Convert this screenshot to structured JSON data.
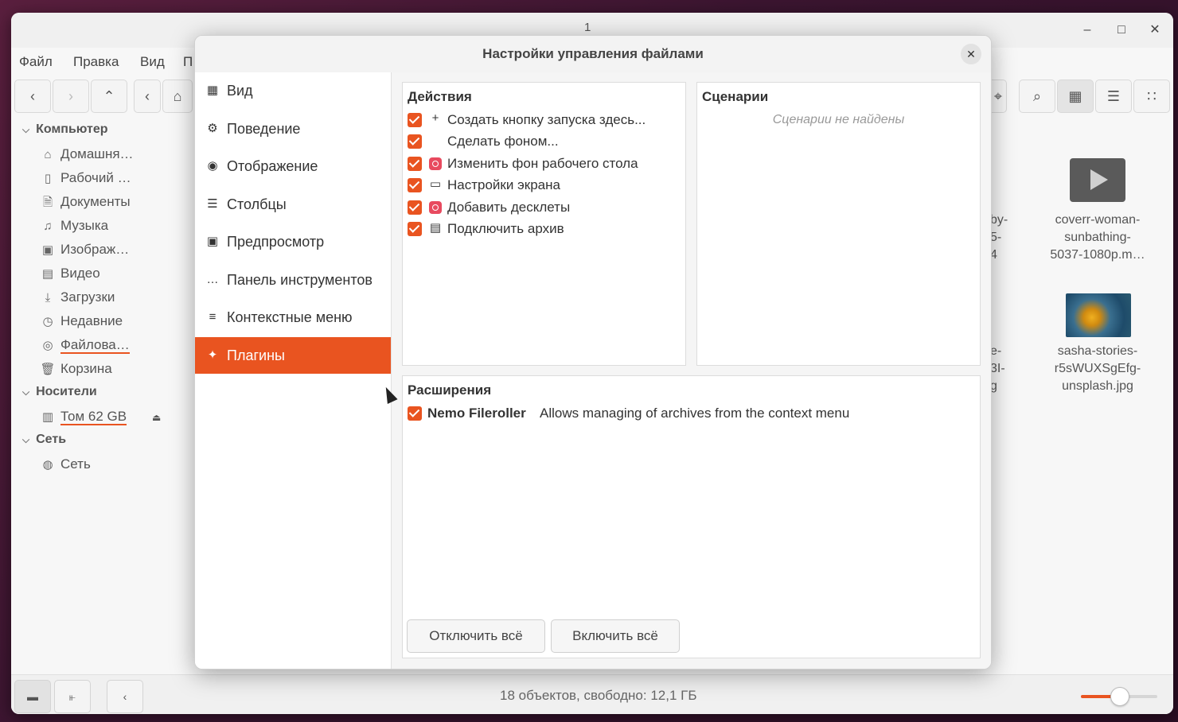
{
  "main_window": {
    "title": "1",
    "controls": {
      "minimize": "–",
      "maximize": "□",
      "close": "✕"
    },
    "menu": [
      "Файл",
      "Правка",
      "Вид",
      "П"
    ],
    "sidebar": {
      "computer_title": "Компьютер",
      "computer_items": [
        {
          "label": "Домашня…",
          "icon": "home-icon"
        },
        {
          "label": "Рабочий …",
          "icon": "desktop-icon"
        },
        {
          "label": "Документы",
          "icon": "documents-icon"
        },
        {
          "label": "Музыка",
          "icon": "music-icon"
        },
        {
          "label": "Изображ…",
          "icon": "pictures-icon"
        },
        {
          "label": "Видео",
          "icon": "video-icon"
        },
        {
          "label": "Загрузки",
          "icon": "downloads-icon"
        },
        {
          "label": "Недавние",
          "icon": "recent-icon"
        },
        {
          "label": "Файлова…",
          "icon": "filesystem-icon"
        },
        {
          "label": "Корзина",
          "icon": "trash-icon"
        }
      ],
      "devices_title": "Носители",
      "devices_items": [
        {
          "label": "Том 62 GB",
          "icon": "drive-icon"
        }
      ],
      "network_title": "Сеть",
      "network_items": [
        {
          "label": "Сеть",
          "icon": "network-icon"
        }
      ]
    },
    "files": [
      {
        "name_lines": [
          "coverr-woman-",
          "sunbathing-",
          "5037-1080p.m…"
        ],
        "thumb": "video-thumbnail"
      },
      {
        "name_lines": [
          "sasha-stories-",
          "r5sWUXSgEfg-",
          "unsplash.jpg"
        ],
        "thumb": "image-thumbnail"
      }
    ],
    "partial_file_labels": [
      "by-",
      "5-",
      "4",
      "e-",
      "3I-",
      "g"
    ],
    "status": "18 объектов, свободно: 12,1 ГБ",
    "zoom_level": 0.5
  },
  "dialog": {
    "title": "Настройки управления файлами",
    "close": "✕",
    "nav": [
      {
        "label": "Вид",
        "icon": "grid-icon",
        "selected": false
      },
      {
        "label": "Поведение",
        "icon": "gear-icon",
        "selected": false
      },
      {
        "label": "Отображение",
        "icon": "eye-icon",
        "selected": false
      },
      {
        "label": "Столбцы",
        "icon": "columns-icon",
        "selected": false
      },
      {
        "label": "Предпросмотр",
        "icon": "preview-icon",
        "selected": false
      },
      {
        "label": "Панель инструментов",
        "icon": "toolbar-icon",
        "selected": false
      },
      {
        "label": "Контекстные меню",
        "icon": "menu-icon",
        "selected": false
      },
      {
        "label": "Плагины",
        "icon": "puzzle-icon",
        "selected": true
      }
    ],
    "actions": {
      "title": "Действия",
      "items": [
        {
          "label": "Создать кнопку запуска здесь...",
          "icon": "plus-icon",
          "checked": true
        },
        {
          "label": "Сделать фоном...",
          "icon": "",
          "checked": true
        },
        {
          "label": "Изменить фон рабочего стола",
          "icon": "wallpaper-icon",
          "checked": true
        },
        {
          "label": "Настройки экрана",
          "icon": "monitor-icon",
          "checked": true
        },
        {
          "label": "Добавить десклеты",
          "icon": "desklet-icon",
          "checked": true
        },
        {
          "label": "Подключить архив",
          "icon": "archive-icon",
          "checked": true
        }
      ]
    },
    "scripts": {
      "title": "Сценарии",
      "empty": "Сценарии не найдены"
    },
    "extensions": {
      "title": "Расширения",
      "items": [
        {
          "name": "Nemo Fileroller",
          "description": "Allows managing of archives from the context menu",
          "checked": true
        }
      ]
    },
    "buttons": {
      "disable_all": "Отключить всё",
      "enable_all": "Включить всё"
    }
  },
  "colors": {
    "accent": "#e95420"
  }
}
